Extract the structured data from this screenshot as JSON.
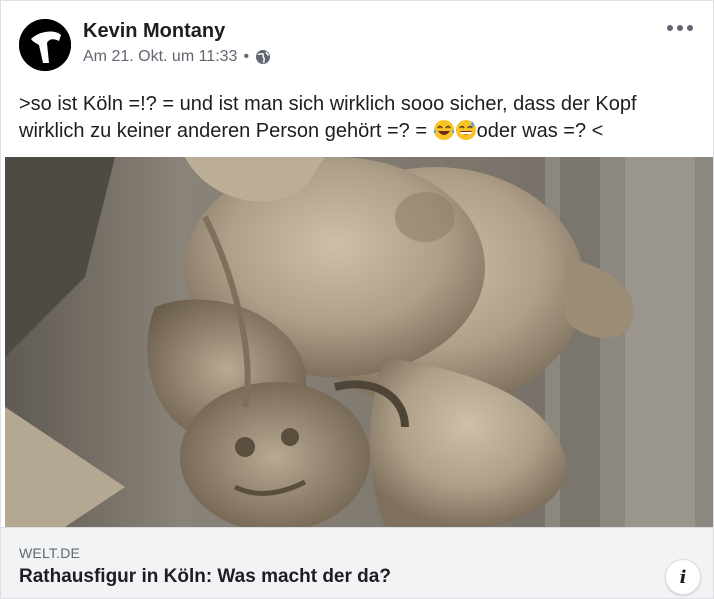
{
  "post": {
    "author": "Kevin Montany",
    "timestamp": "Am 21. Okt. um 11:33",
    "separator": "•",
    "privacy_icon": "globe-icon",
    "more_icon": "ellipsis-icon",
    "text_part1": ">so ist Köln =!? = und ist man sich wirklich sooo sicher, dass der Kopf wirklich zu keiner anderen Person gehört =? = ",
    "text_part2": "oder was =? <",
    "emojis": [
      "laughing-tears-emoji",
      "grinning-sweat-emoji"
    ]
  },
  "link_preview": {
    "domain": "WELT.DE",
    "title": "Rathausfigur in Köln: Was macht der da?",
    "info_label": "i",
    "image_description_icon": "stone-sculpture-photo"
  },
  "colors": {
    "text": "#1c1e21",
    "secondary": "#606770",
    "footer_bg": "#f2f3f5"
  }
}
